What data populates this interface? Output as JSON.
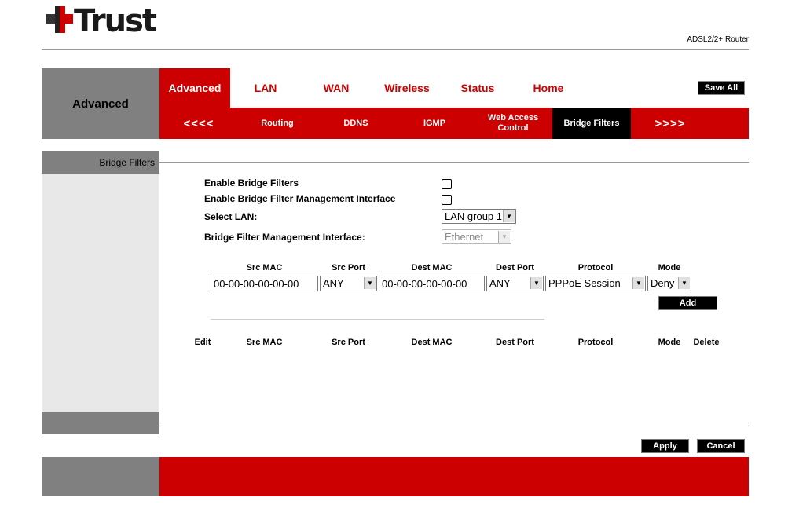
{
  "brand": {
    "name": "Trust",
    "product": "ADSL2/2+ Router",
    "accent": "#cc0000"
  },
  "header": {
    "section_title": "Advanced",
    "save_all": "Save All"
  },
  "nav": {
    "tabs": [
      {
        "label": "Advanced",
        "active": true
      },
      {
        "label": "LAN"
      },
      {
        "label": "WAN"
      },
      {
        "label": "Wireless"
      },
      {
        "label": "Status"
      },
      {
        "label": "Home"
      }
    ],
    "subtabs": [
      {
        "label": "<<<<"
      },
      {
        "label": "Routing"
      },
      {
        "label": "DDNS"
      },
      {
        "label": "IGMP"
      },
      {
        "label": "Web Access Control"
      },
      {
        "label": "Bridge Filters",
        "active": true
      },
      {
        "label": ">>>>"
      }
    ]
  },
  "sidebar": {
    "page_label": "Bridge Filters"
  },
  "form": {
    "enable_bridge_filters": {
      "label": "Enable Bridge Filters",
      "checked": false
    },
    "enable_mgmt_interface": {
      "label": "Enable Bridge Filter Management Interface",
      "checked": false
    },
    "select_lan": {
      "label": "Select LAN:",
      "value": "LAN group 1"
    },
    "mgmt_interface": {
      "label": "Bridge Filter Management Interface:",
      "value": "Ethernet",
      "disabled": true
    }
  },
  "add_row": {
    "headers": [
      "Src MAC",
      "Src Port",
      "Dest MAC",
      "Dest Port",
      "Protocol",
      "Mode"
    ],
    "src_mac": "00-00-00-00-00-00",
    "src_port": "ANY",
    "dest_mac": "00-00-00-00-00-00",
    "dest_port": "ANY",
    "protocol": "PPPoE Session",
    "mode": "Deny",
    "add_label": "Add"
  },
  "rules_table": {
    "headers": [
      "Edit",
      "Src MAC",
      "Src Port",
      "Dest MAC",
      "Dest Port",
      "Protocol",
      "Mode",
      "Delete"
    ],
    "rows": []
  },
  "actions": {
    "apply": "Apply",
    "cancel": "Cancel"
  }
}
